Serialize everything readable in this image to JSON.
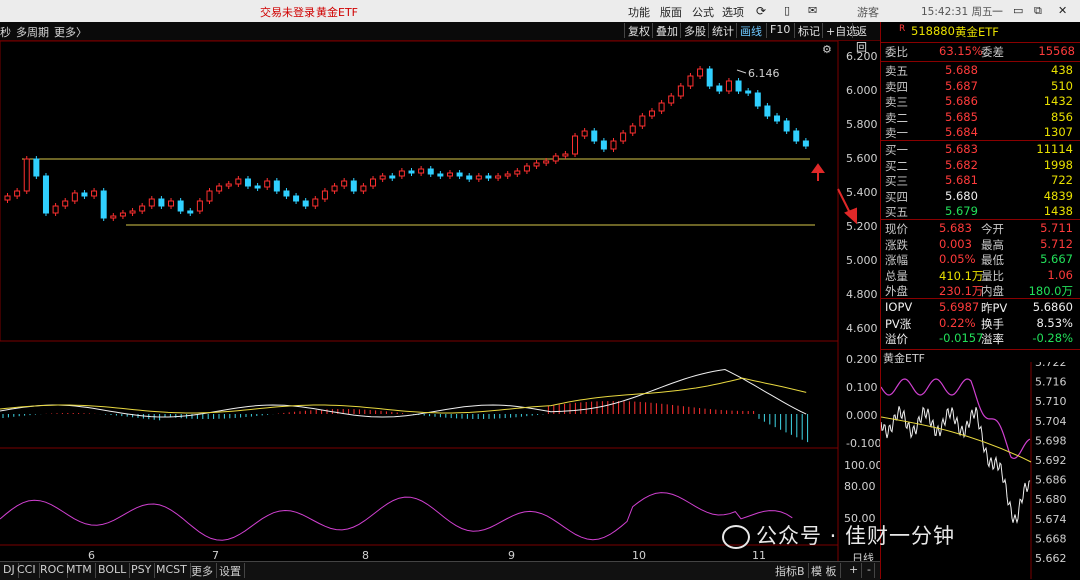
{
  "titlebar": {
    "login_status": "交易未登录",
    "symbol": "黄金ETF",
    "menu": [
      "功能",
      "版面",
      "公式",
      "选项"
    ],
    "guest": "游客",
    "clock": "15:42:31 周五"
  },
  "toolbar": {
    "left": [
      "秒",
      "多周期",
      "更多〉"
    ],
    "buttons": [
      "复权",
      "叠加",
      "多股",
      "统计",
      "画线",
      "F10",
      "标记",
      "返回"
    ],
    "add_watch": "+自选"
  },
  "chart": {
    "price_axis": [
      "6.200",
      "6.000",
      "5.800",
      "5.600",
      "5.400",
      "5.200",
      "5.000",
      "4.800",
      "4.600"
    ],
    "macd_axis": [
      "0.200",
      "0.100",
      "0.000",
      "-0.100"
    ],
    "osc_axis": [
      "100.00",
      "80.00",
      "50.00"
    ],
    "dates": [
      "6",
      "7",
      "8",
      "9",
      "10",
      "11"
    ],
    "high_label": "6.146",
    "candles_note": ""
  },
  "indicator_tabs": [
    "DJ",
    "CCI",
    "ROC",
    "MTM",
    "BOLL",
    "PSY",
    "MCST",
    "更多",
    "设置"
  ],
  "bottom_right": [
    "指标B",
    "模 板",
    "+",
    "-"
  ],
  "day_line": "日线",
  "quote": {
    "header": {
      "flag": "R",
      "code": "518880",
      "name": "黄金ETF"
    },
    "weibi_label": "委比",
    "weibi": "63.15%",
    "weicha_label": "委差",
    "weicha": "15568",
    "asks": [
      {
        "label": "卖五",
        "price": "5.688",
        "vol": "438"
      },
      {
        "label": "卖四",
        "price": "5.687",
        "vol": "510"
      },
      {
        "label": "卖三",
        "price": "5.686",
        "vol": "1432"
      },
      {
        "label": "卖二",
        "price": "5.685",
        "vol": "856"
      },
      {
        "label": "卖一",
        "price": "5.684",
        "vol": "1307"
      }
    ],
    "bids": [
      {
        "label": "买一",
        "price": "5.683",
        "vol": "11114"
      },
      {
        "label": "买二",
        "price": "5.682",
        "vol": "1998"
      },
      {
        "label": "买三",
        "price": "5.681",
        "vol": "722"
      },
      {
        "label": "买四",
        "price": "5.680",
        "vol": "4839"
      },
      {
        "label": "买五",
        "price": "5.679",
        "vol": "1438"
      }
    ],
    "stats": [
      {
        "l1": "现价",
        "v1": "5.683",
        "l2": "今开",
        "v2": "5.711"
      },
      {
        "l1": "涨跌",
        "v1": "0.003",
        "l2": "最高",
        "v2": "5.712"
      },
      {
        "l1": "涨幅",
        "v1": "0.05%",
        "l2": "最低",
        "v2": "5.667"
      },
      {
        "l1": "总量",
        "v1": "410.1万",
        "l2": "量比",
        "v2": "1.06"
      },
      {
        "l1": "外盘",
        "v1": "230.1万",
        "l2": "内盘",
        "v2": "180.0万"
      }
    ],
    "iopv": [
      {
        "l1": "IOPV",
        "v1": "5.6987",
        "l2": "昨PV",
        "v2": "5.6860"
      },
      {
        "l1": "PV涨",
        "v1": "0.22%",
        "l2": "换手",
        "v2": "8.53%"
      },
      {
        "l1": "溢价",
        "v1": "-0.0157",
        "l2": "溢率",
        "v2": "-0.28%"
      }
    ]
  },
  "intraday": {
    "title": "黄金ETF",
    "axis": [
      "5.722",
      "5.716",
      "5.710",
      "5.704",
      "5.698",
      "5.692",
      "5.686",
      "5.680",
      "5.674",
      "5.668",
      "5.662"
    ]
  },
  "watermark": "公众号 · 佳财一分钟"
}
